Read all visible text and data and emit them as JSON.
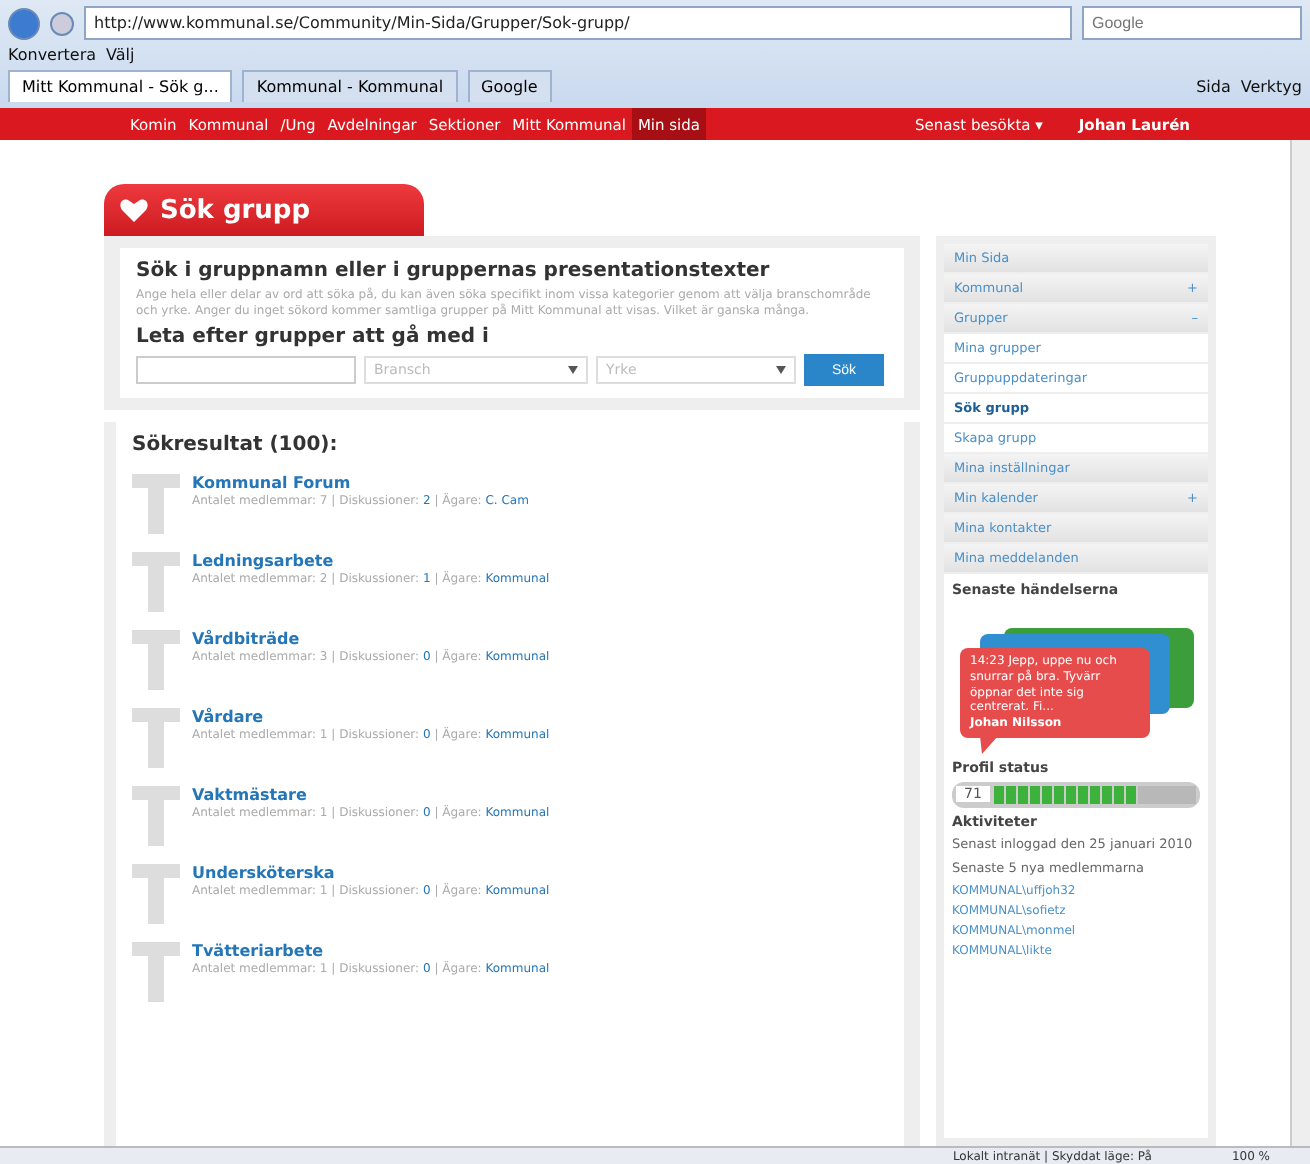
{
  "browser": {
    "address": "http://www.kommunal.se/Community/Min-Sida/Grupper/Sok-grupp/",
    "search_placeholder": "Google",
    "links": [
      "Konvertera",
      "Välj"
    ],
    "tabs": [
      {
        "label": "Mitt Kommunal - Sök g...",
        "selected": true
      },
      {
        "label": "Kommunal - Kommunal",
        "selected": false
      },
      {
        "label": "Google",
        "selected": false
      }
    ],
    "tools": [
      "Sida",
      "Verktyg"
    ]
  },
  "nav": {
    "items": [
      {
        "label": "Komin",
        "selected": false
      },
      {
        "label": "Kommunal",
        "selected": false
      },
      {
        "label": "/Ung",
        "selected": false
      },
      {
        "label": "Avdelningar",
        "selected": false
      },
      {
        "label": "Sektioner",
        "selected": false
      },
      {
        "label": "Mitt Kommunal",
        "selected": false
      },
      {
        "label": "Min sida",
        "selected": true
      }
    ],
    "recent": "Senast besökta ▾",
    "user": "Johan Laurén"
  },
  "page_title": "Sök grupp",
  "search": {
    "heading": "Sök i gruppnamn eller i gruppernas presentationstexter",
    "description": "Ange hela eller delar av ord att söka på, du kan även söka specifikt inom vissa kategorier genom att välja branschområde och yrke. Anger du inget sökord kommer samtliga grupper på Mitt Kommunal att visas. Vilket är ganska många.",
    "subheading": "Leta efter grupper att gå med i",
    "branch_placeholder": "Bransch",
    "job_placeholder": "Yrke",
    "button": "Sök"
  },
  "results": {
    "heading": "Sökresultat (100):",
    "items": [
      {
        "name": "Kommunal Forum",
        "members_label": "Antalet medlemmar: 7 | Diskussioner:",
        "discussions": "2",
        "owner_label": "| Ägare:",
        "owner": "C. Cam"
      },
      {
        "name": "Ledningsarbete",
        "members_label": "Antalet medlemmar: 2 | Diskussioner:",
        "discussions": "1",
        "owner_label": "| Ägare:",
        "owner": "Kommunal"
      },
      {
        "name": "Vårdbiträde",
        "members_label": "Antalet medlemmar: 3 | Diskussioner:",
        "discussions": "0",
        "owner_label": "| Ägare:",
        "owner": "Kommunal"
      },
      {
        "name": "Vårdare",
        "members_label": "Antalet medlemmar: 1 | Diskussioner:",
        "discussions": "0",
        "owner_label": "| Ägare:",
        "owner": "Kommunal"
      },
      {
        "name": "Vaktmästare",
        "members_label": "Antalet medlemmar: 1 | Diskussioner:",
        "discussions": "0",
        "owner_label": "| Ägare:",
        "owner": "Kommunal"
      },
      {
        "name": "Undersköterska",
        "members_label": "Antalet medlemmar: 1 | Diskussioner:",
        "discussions": "0",
        "owner_label": "| Ägare:",
        "owner": "Kommunal"
      },
      {
        "name": "Tvätteriarbete",
        "members_label": "Antalet medlemmar: 1 | Diskussioner:",
        "discussions": "0",
        "owner_label": "| Ägare:",
        "owner": "Kommunal"
      }
    ]
  },
  "sidebar": {
    "items": [
      {
        "kind": "header",
        "label": "Min Sida",
        "selected": false
      },
      {
        "kind": "header",
        "label": "Kommunal",
        "toggle": "+",
        "selected": false
      },
      {
        "kind": "header",
        "label": "Grupper",
        "toggle": "–",
        "selected": false
      },
      {
        "kind": "sub",
        "label": "Mina grupper",
        "selected": false
      },
      {
        "kind": "sub",
        "label": "Gruppuppdateringar",
        "selected": false
      },
      {
        "kind": "sub",
        "label": "Sök grupp",
        "selected": true
      },
      {
        "kind": "sub",
        "label": "Skapa grupp",
        "selected": false
      },
      {
        "kind": "header",
        "label": "Mina inställningar",
        "selected": false
      },
      {
        "kind": "header",
        "label": "Min kalender",
        "toggle": "+",
        "selected": false
      },
      {
        "kind": "header",
        "label": "Mina kontakter",
        "selected": false
      },
      {
        "kind": "header",
        "label": "Mina meddelanden",
        "selected": false
      }
    ],
    "events_heading": "Senaste händelserna",
    "bubble": {
      "text": "14:23 Jepp, uppe nu och snurrar på bra. Tyvärr öppnar det inte sig centrerat. Fi...",
      "author": "Johan Nilsson"
    },
    "profile": {
      "heading": "Profil status",
      "value": "71",
      "level": 0.71
    },
    "activities": {
      "heading": "Aktiviteter",
      "last_login": "Senast inloggad den 25 januari 2010",
      "new_members": "Senaste 5 nya medlemmarna",
      "members": [
        "KOMMUNAL\\uffjoh32",
        "KOMMUNAL\\sofietz",
        "KOMMUNAL\\monmel",
        "KOMMUNAL\\likte"
      ]
    }
  },
  "status_bar": {
    "zone": "Lokalt intranät | Skyddat läge: På",
    "zoom": "100 %"
  }
}
